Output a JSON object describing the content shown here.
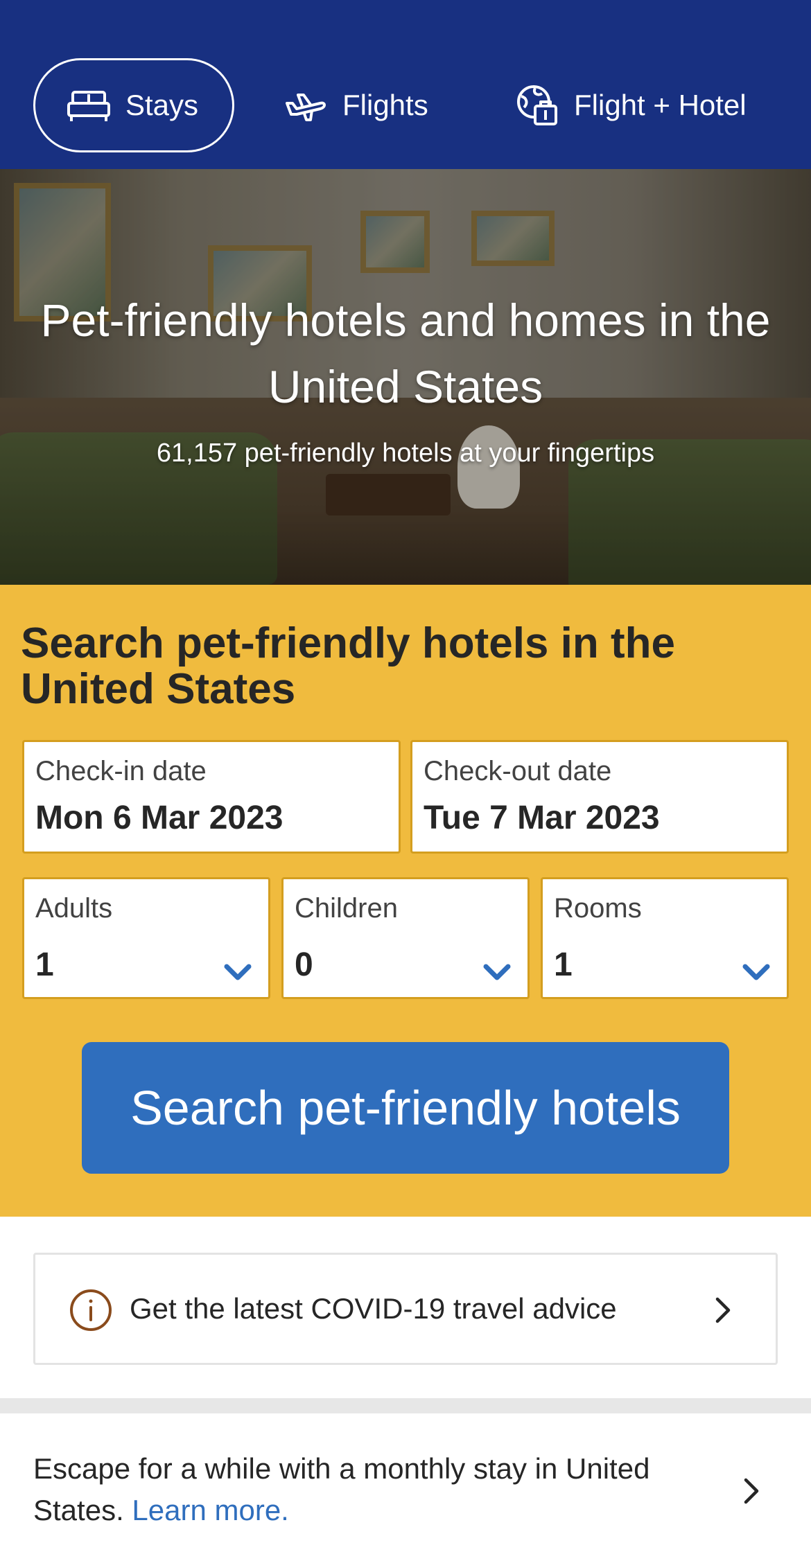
{
  "nav": {
    "tabs": [
      {
        "label": "Stays",
        "icon": "bed-icon",
        "active": true
      },
      {
        "label": "Flights",
        "icon": "plane-icon",
        "active": false
      },
      {
        "label": "Flight + Hotel",
        "icon": "globe-luggage-icon",
        "active": false
      }
    ]
  },
  "hero": {
    "title": "Pet-friendly hotels and homes in the United States",
    "subtitle": "61,157 pet-friendly hotels at your fingertips"
  },
  "search": {
    "heading": "Search pet-friendly hotels in the United States",
    "checkin": {
      "label": "Check-in date",
      "value": "Mon 6 Mar 2023"
    },
    "checkout": {
      "label": "Check-out date",
      "value": "Tue 7 Mar 2023"
    },
    "adults": {
      "label": "Adults",
      "value": "1"
    },
    "children": {
      "label": "Children",
      "value": "0"
    },
    "rooms": {
      "label": "Rooms",
      "value": "1"
    },
    "button_label": "Search pet-friendly hotels"
  },
  "covid": {
    "text": "Get the latest COVID-19 travel advice"
  },
  "monthly": {
    "text": "Escape for a while with a monthly stay in United States. ",
    "link": "Learn more."
  },
  "colors": {
    "nav_bg": "#183081",
    "panel_bg": "#f0bb3e",
    "button_bg": "#2f6ebd",
    "link": "#2f6ebd",
    "info_icon": "#8a4b1c"
  }
}
